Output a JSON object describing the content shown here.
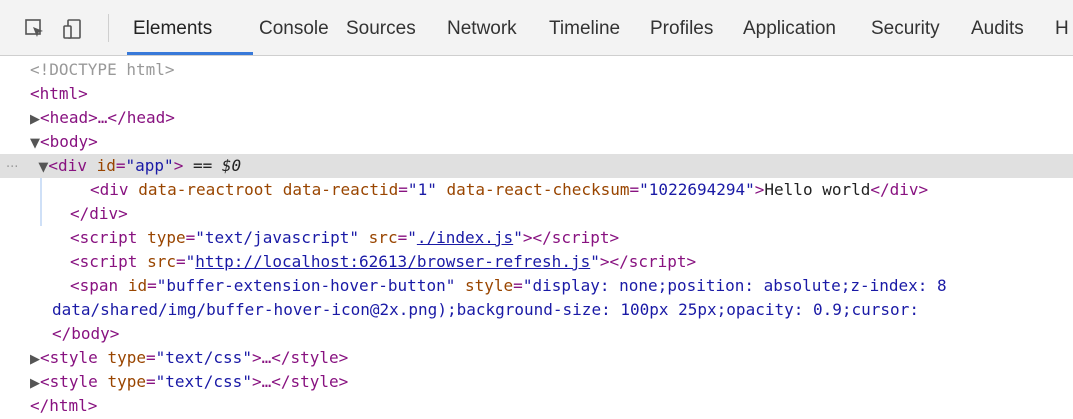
{
  "toolbar": {
    "tabs": [
      "Elements",
      "Console",
      "Sources",
      "Network",
      "Timeline",
      "Profiles",
      "Application",
      "Security",
      "Audits",
      "H"
    ],
    "active_tab": "Elements",
    "icons": [
      "inspect-element-icon",
      "device-mode-icon"
    ]
  },
  "dom": {
    "doctype": "<!DOCTYPE html>",
    "html_open": "<html>",
    "head_collapsed": "<head>…</head>",
    "body_open": "<body>",
    "div_app_tag": "div",
    "div_app_id_attr": "id",
    "div_app_id_val": "app",
    "selection_marker": "== $0",
    "react_div": {
      "tag": "div",
      "attr1": "data-reactroot",
      "attr2": "data-reactid",
      "attr2_val": "1",
      "attr3": "data-react-checksum",
      "attr3_val": "1022694294",
      "text": "Hello world"
    },
    "div_close": "</div>",
    "script1": {
      "attr": "type",
      "val": "text/javascript",
      "attr2": "src",
      "src": "./index.js"
    },
    "script2": {
      "attr": "src",
      "src": "http://localhost:62613/browser-refresh.js"
    },
    "span": {
      "attr": "id",
      "id_val": "buffer-extension-hover-button",
      "attr2": "style",
      "style_start": "display: none;position: absolute;z-index: 8",
      "style_cont": "data/shared/img/buffer-hover-icon@2x.png);background-size: 100px 25px;opacity: 0.9;cursor:"
    },
    "body_close": "</body>",
    "style_collapsed_1": {
      "attr": "type",
      "val": "text/css"
    },
    "style_collapsed_2": {
      "attr": "type",
      "val": "text/css"
    },
    "html_close": "</html>"
  },
  "colors": {
    "tag": "#881280",
    "attr": "#994500",
    "value": "#1a1aa6",
    "selection": "#e0e0e0",
    "accent": "#3879d9"
  }
}
